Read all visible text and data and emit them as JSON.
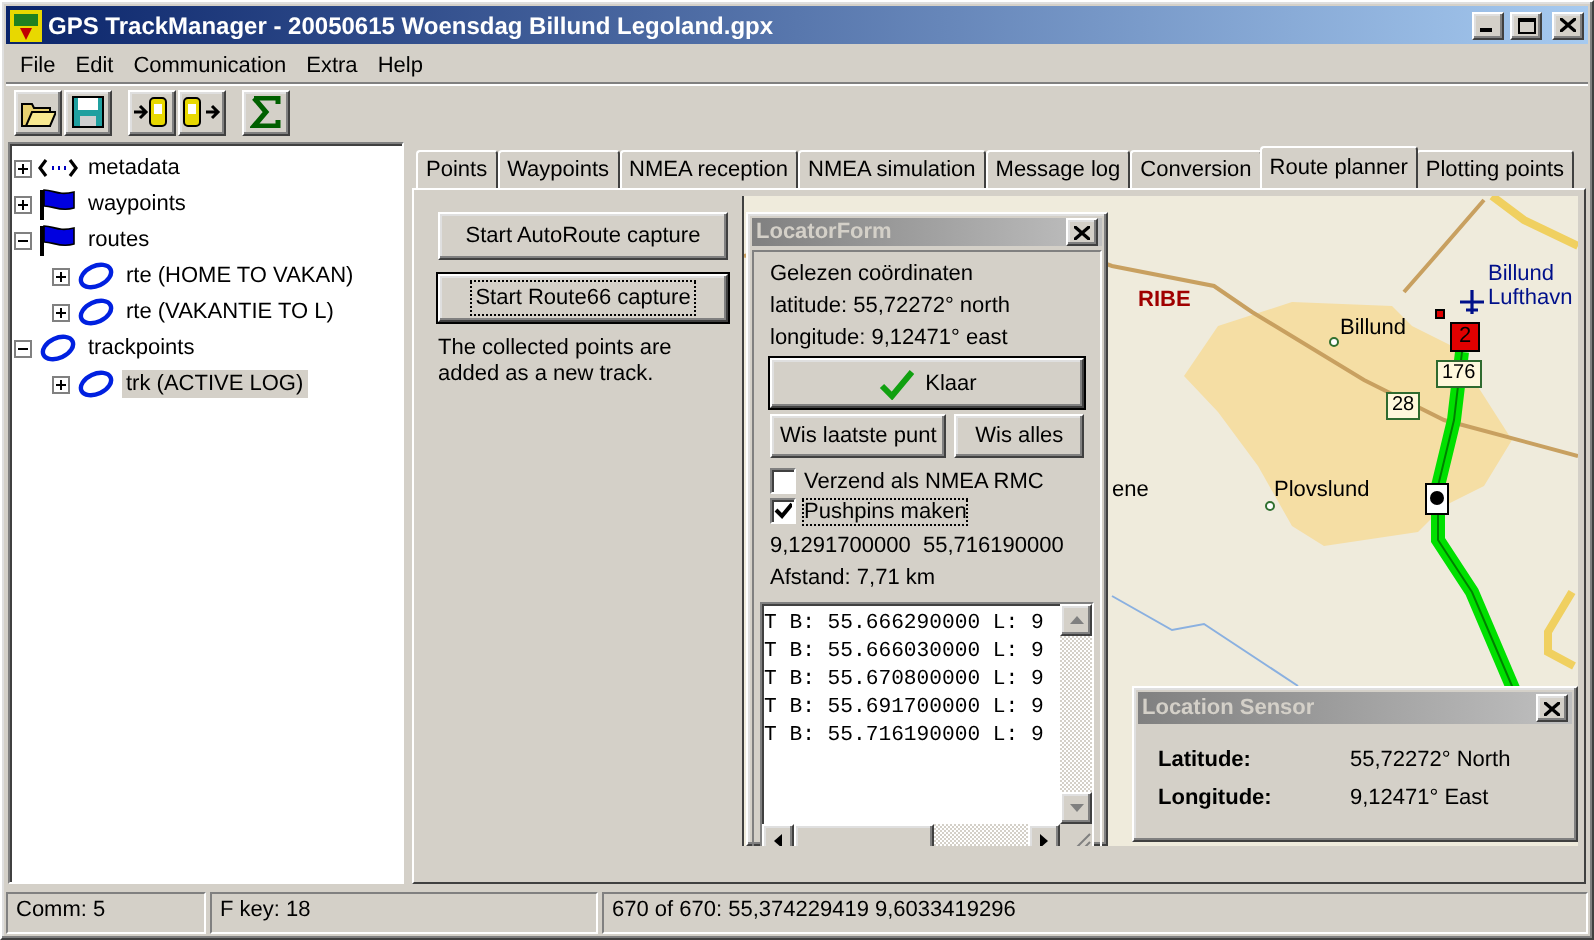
{
  "window": {
    "title": "GPS TrackManager - 20050615 Woensdag Billund Legoland.gpx"
  },
  "menu": [
    "File",
    "Edit",
    "Communication",
    "Extra",
    "Help"
  ],
  "tree": [
    {
      "label": "metadata",
      "kind": "metadata",
      "expanded": false,
      "selected": false
    },
    {
      "label": "waypoints",
      "kind": "flag",
      "expanded": false,
      "selected": false
    },
    {
      "label": "routes",
      "kind": "flag",
      "expanded": true,
      "selected": false,
      "children": [
        {
          "label": "rte (HOME TO VAKAN)",
          "kind": "route",
          "expanded": false,
          "selected": false
        },
        {
          "label": "rte (VAKANTIE TO L)",
          "kind": "route",
          "expanded": false,
          "selected": false
        }
      ]
    },
    {
      "label": "trackpoints",
      "kind": "route",
      "expanded": true,
      "selected": false,
      "children": [
        {
          "label": "trk (ACTIVE LOG)",
          "kind": "route",
          "expanded": false,
          "selected": true
        }
      ]
    }
  ],
  "tabs": [
    {
      "label": "Points",
      "selected": false
    },
    {
      "label": "Waypoints",
      "selected": false
    },
    {
      "label": "NMEA reception",
      "selected": false
    },
    {
      "label": "NMEA simulation",
      "selected": false
    },
    {
      "label": "Message log",
      "selected": false
    },
    {
      "label": "Conversion",
      "selected": false
    },
    {
      "label": "Route planner",
      "selected": true
    },
    {
      "label": "Plotting points",
      "selected": false
    }
  ],
  "route_planner": {
    "buttons": [
      {
        "label": "Start AutoRoute capture",
        "focused": false
      },
      {
        "label": "Start Route66 capture",
        "focused": true
      }
    ],
    "note": "The collected points are added as a new track."
  },
  "map": {
    "labels": [
      {
        "text": "RIBE",
        "kind": "city"
      },
      {
        "text": "Billund",
        "kind": "town"
      },
      {
        "text": "ene",
        "kind": "place"
      },
      {
        "text": "Plovslund",
        "kind": "town"
      },
      {
        "text": "Billund Lufthavn",
        "kind": "airport"
      },
      {
        "text": "176",
        "kind": "road"
      },
      {
        "text": "28",
        "kind": "road"
      },
      {
        "text": "2",
        "kind": "marker"
      }
    ]
  },
  "locator_form": {
    "title": "LocatorForm",
    "heading": "Gelezen coördinaten",
    "latitude": "latitude: 55,72272° north",
    "longitude": "longitude: 9,12471° east",
    "ok_button": "Klaar",
    "buttons": [
      "Wis laatste punt",
      "Wis alles"
    ],
    "checkboxes": [
      {
        "label": "Verzend als NMEA RMC",
        "checked": false
      },
      {
        "label": "Pushpins maken",
        "checked": true
      }
    ],
    "coordinates": "9,1291700000  55,716190000",
    "distance": "Afstand: 7,71 km",
    "log": [
      "T B: 55.666290000 L: 9",
      "T B: 55.666030000 L: 9",
      "T B: 55.670800000 L: 9",
      "T B: 55.691700000 L: 9",
      "T B: 55.716190000 L: 9"
    ]
  },
  "location_sensor": {
    "title": "Location Sensor",
    "rows": [
      {
        "label": "Latitude:",
        "value": "55,72272° North"
      },
      {
        "label": "Longitude:",
        "value": "9,12471° East"
      }
    ]
  },
  "status_bar": [
    "Comm: 5",
    "F key: 18",
    "670 of 670: 55,374229419  9,6033419296"
  ]
}
